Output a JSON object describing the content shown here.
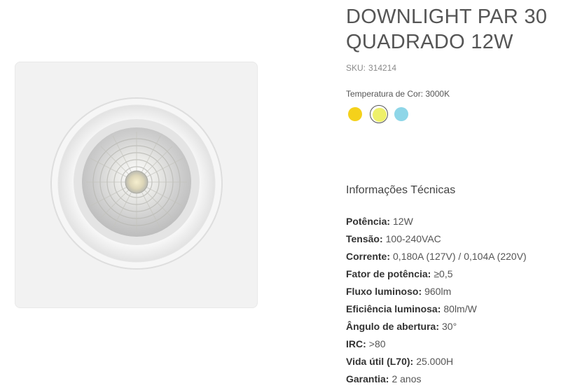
{
  "product": {
    "title_line1": "DOWNLIGHT PAR 30",
    "title_line2": "QUADRADO 12W",
    "sku_label": "SKU:",
    "sku_value": "314214",
    "color_temp_label": "Temperatura de Cor: 3000K",
    "swatches": [
      {
        "name": "swatch-yellow",
        "color": "#f4d11b",
        "selected": false
      },
      {
        "name": "swatch-warm",
        "color": "#eef06a",
        "selected": true
      },
      {
        "name": "swatch-cool",
        "color": "#8ed6e8",
        "selected": false
      }
    ]
  },
  "technical": {
    "heading": "Informações Técnicas",
    "specs": [
      {
        "label": "Potência:",
        "value": "12W"
      },
      {
        "label": "Tensão:",
        "value": "100-240VAC"
      },
      {
        "label": "Corrente:",
        "value": "0,180A (127V) / 0,104A (220V)"
      },
      {
        "label": "Fator de potência:",
        "value": "≥0,5"
      },
      {
        "label": "Fluxo luminoso:",
        "value": "960lm"
      },
      {
        "label": "Eficiência luminosa:",
        "value": "80lm/W"
      },
      {
        "label": "Ângulo de abertura:",
        "value": "30°"
      },
      {
        "label": "IRC:",
        "value": ">80"
      },
      {
        "label": "Vida útil (L70):",
        "value": "25.000H"
      },
      {
        "label": "Garantia:",
        "value": "2 anos"
      }
    ]
  },
  "icons": {
    "product_photo": "downlight-square-product-image"
  }
}
